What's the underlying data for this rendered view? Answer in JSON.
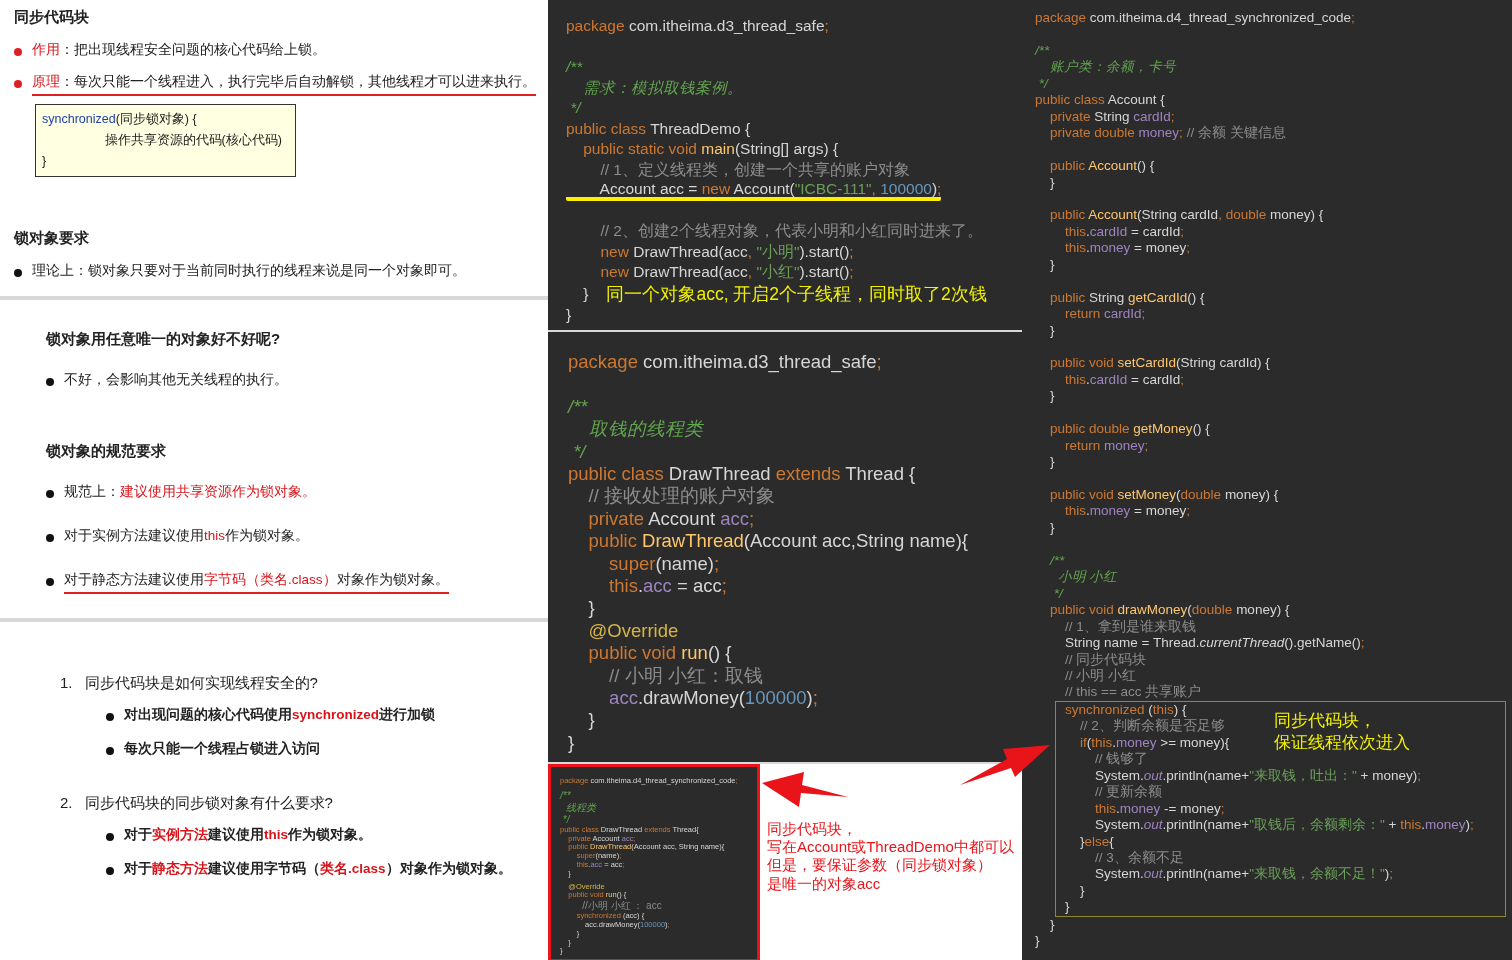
{
  "slides": [
    {
      "kind": "notes",
      "sections": [
        {
          "heading": "同步代码块",
          "bullets": [
            {
              "color": "#e02020",
              "underlined": false,
              "segments": [
                {
                  "kind": "red",
                  "text": "作用"
                },
                {
                  "kind": "plain",
                  "text": "：把出现线程安全问题的核心代码给上锁。"
                }
              ]
            },
            {
              "color": "#e02020",
              "underlined": true,
              "segments": [
                {
                  "kind": "red",
                  "text": "原理"
                },
                {
                  "kind": "plain",
                  "text": "：每次只能一个线程进入，执行完毕后自动解锁，其他线程才可以进来执行。"
                }
              ]
            }
          ],
          "code_box": [
            [
              {
                "kind": "blue",
                "text": "synchronized"
              },
              {
                "kind": "plain",
                "text": "(同步锁对象) {"
              }
            ],
            [
              {
                "kind": "plain",
                "text": "                  操作共享资源的代码(核心代码)"
              }
            ],
            [
              {
                "kind": "plain",
                "text": "}"
              }
            ]
          ]
        },
        {
          "heading": "锁对象要求",
          "bullets": [
            {
              "underlined": false,
              "segments": [
                {
                  "kind": "plain",
                  "text": "理论上：锁对象只要对于当前同时执行的线程来说是同一个对象即可。"
                }
              ]
            }
          ]
        }
      ]
    },
    {
      "kind": "notes",
      "sections": [
        {
          "heading": "锁对象用任意唯一的对象好不好呢?",
          "bullets": [
            {
              "underlined": false,
              "segments": [
                {
                  "kind": "plain",
                  "text": "不好，会影响其他无关线程的执行。"
                }
              ]
            }
          ]
        },
        {
          "heading": "锁对象的规范要求",
          "bullets": [
            {
              "underlined": false,
              "segments": [
                {
                  "kind": "plain",
                  "text": "规范上："
                },
                {
                  "kind": "red",
                  "text": "建议使用共享资源作为锁对象。"
                }
              ]
            },
            {
              "underlined": false,
              "segments": [
                {
                  "kind": "plain",
                  "text": "对于实例方法建议使用"
                },
                {
                  "kind": "red",
                  "text": "this"
                },
                {
                  "kind": "plain",
                  "text": "作为锁对象。"
                }
              ]
            },
            {
              "underlined": true,
              "segments": [
                {
                  "kind": "plain",
                  "text": "对于静态方法建议使用"
                },
                {
                  "kind": "red",
                  "text": "字节码（类名.class）"
                },
                {
                  "kind": "plain",
                  "text": "对象作为锁对象。"
                }
              ]
            }
          ]
        }
      ]
    },
    {
      "kind": "quiz",
      "sections": [
        {
          "number": "1.",
          "heading": "同步代码块是如何实现线程安全的?",
          "bullets": [
            {
              "segments": [
                {
                  "kind": "plain",
                  "text": "对出现问题的核心代码使用"
                },
                {
                  "kind": "red",
                  "text": "synchronized"
                },
                {
                  "kind": "plain",
                  "text": "进行加锁"
                }
              ]
            },
            {
              "segments": [
                {
                  "kind": "plain",
                  "text": "每次只能一个线程占锁进入访问"
                }
              ]
            }
          ]
        },
        {
          "number": "2.",
          "heading": "同步代码块的同步锁对象有什么要求?",
          "bullets": [
            {
              "segments": [
                {
                  "kind": "plain",
                  "text": "对于"
                },
                {
                  "kind": "red",
                  "text": "实例方法"
                },
                {
                  "kind": "plain",
                  "text": "建议使用"
                },
                {
                  "kind": "red",
                  "text": "this"
                },
                {
                  "kind": "plain",
                  "text": "作为锁对象。"
                }
              ]
            },
            {
              "segments": [
                {
                  "kind": "plain",
                  "text": "对于"
                },
                {
                  "kind": "red",
                  "text": "静态方法"
                },
                {
                  "kind": "plain",
                  "text": "建议使用字节码（"
                },
                {
                  "kind": "red",
                  "text": "类名.class"
                },
                {
                  "kind": "plain",
                  "text": "）对象作为锁对象。"
                }
              ]
            }
          ]
        }
      ]
    }
  ],
  "editor_top": {
    "lines": [
      {
        "kind": "code",
        "tokens": [
          {
            "kind": "kw",
            "text": "package "
          },
          {
            "kind": "plain",
            "text": "com.itheima.d3_thread_safe"
          },
          {
            "kind": "kw",
            "text": ";"
          }
        ]
      },
      {
        "kind": "blank"
      },
      {
        "kind": "code",
        "tokens": [
          {
            "kind": "doc",
            "text": "/**"
          }
        ]
      },
      {
        "kind": "code",
        "tokens": [
          {
            "kind": "doc",
            "text": "    需求：模拟取钱案例。"
          }
        ]
      },
      {
        "kind": "code",
        "tokens": [
          {
            "kind": "doc",
            "text": " */"
          }
        ]
      },
      {
        "kind": "code",
        "tokens": [
          {
            "kind": "kw",
            "text": "public class "
          },
          {
            "kind": "plain",
            "text": "ThreadDemo {"
          }
        ]
      },
      {
        "kind": "code",
        "tokens": [
          {
            "kind": "kw",
            "text": "    public static void "
          },
          {
            "kind": "method",
            "text": "main"
          },
          {
            "kind": "plain",
            "text": "(String[] args) {"
          }
        ]
      },
      {
        "kind": "code",
        "tokens": [
          {
            "kind": "comment",
            "text": "        // 1、定义线程类，创建一个共享的账户对象"
          }
        ]
      },
      {
        "kind": "code",
        "underlined": true,
        "tokens": [
          {
            "kind": "plain",
            "text": "        Account acc = "
          },
          {
            "kind": "kw",
            "text": "new "
          },
          {
            "kind": "plain",
            "text": "Account("
          },
          {
            "kind": "str",
            "text": "\"ICBC-111\""
          },
          {
            "kind": "kw",
            "text": ", "
          },
          {
            "kind": "num",
            "text": "100000"
          },
          {
            "kind": "plain",
            "text": ")"
          },
          {
            "kind": "kw",
            "text": ";"
          }
        ]
      },
      {
        "kind": "blank"
      },
      {
        "kind": "code",
        "tokens": [
          {
            "kind": "comment",
            "text": "        // 2、创建2个线程对象，代表小明和小红同时进来了。"
          }
        ]
      },
      {
        "kind": "code",
        "tokens": [
          {
            "kind": "kw",
            "text": "        new "
          },
          {
            "kind": "plain",
            "text": "DrawThread(acc"
          },
          {
            "kind": "kw",
            "text": ", "
          },
          {
            "kind": "str",
            "text": "\"小明\""
          },
          {
            "kind": "plain",
            "text": ").start()"
          },
          {
            "kind": "kw",
            "text": ";"
          }
        ]
      },
      {
        "kind": "code",
        "tokens": [
          {
            "kind": "kw",
            "text": "        new "
          },
          {
            "kind": "plain",
            "text": "DrawThread(acc"
          },
          {
            "kind": "kw",
            "text": ", "
          },
          {
            "kind": "str",
            "text": "\"小红\""
          },
          {
            "kind": "plain",
            "text": ").start()"
          },
          {
            "kind": "kw",
            "text": ";"
          }
        ]
      },
      {
        "kind": "code",
        "note": "同一个对象acc, 开启2个子线程，同时取了2次钱",
        "tokens": [
          {
            "kind": "plain",
            "text": "    }"
          }
        ]
      },
      {
        "kind": "code",
        "tokens": [
          {
            "kind": "plain",
            "text": "}"
          }
        ]
      }
    ]
  },
  "editor_bottom": {
    "lines": [
      {
        "kind": "code",
        "tokens": [
          {
            "kind": "kw",
            "text": "package "
          },
          {
            "kind": "plain",
            "text": "com.itheima.d3_thread_safe"
          },
          {
            "kind": "kw",
            "text": ";"
          }
        ]
      },
      {
        "kind": "blank"
      },
      {
        "kind": "code",
        "tokens": [
          {
            "kind": "doc",
            "text": "/**"
          }
        ]
      },
      {
        "kind": "code",
        "tokens": [
          {
            "kind": "doc",
            "text": "    取钱的线程类"
          }
        ]
      },
      {
        "kind": "code",
        "tokens": [
          {
            "kind": "doc",
            "text": " */"
          }
        ]
      },
      {
        "kind": "code",
        "tokens": [
          {
            "kind": "kw",
            "text": "public class "
          },
          {
            "kind": "plain",
            "text": "DrawThread "
          },
          {
            "kind": "kw",
            "text": "extends "
          },
          {
            "kind": "plain",
            "text": "Thread {"
          }
        ]
      },
      {
        "kind": "code",
        "tokens": [
          {
            "kind": "comment",
            "text": "    // 接收处理的账户对象"
          }
        ]
      },
      {
        "kind": "code",
        "tokens": [
          {
            "kind": "kw",
            "text": "    private "
          },
          {
            "kind": "plain",
            "text": "Account "
          },
          {
            "kind": "field",
            "text": "acc"
          },
          {
            "kind": "kw",
            "text": ";"
          }
        ]
      },
      {
        "kind": "code",
        "tokens": [
          {
            "kind": "kw",
            "text": "    public "
          },
          {
            "kind": "method",
            "text": "DrawThread"
          },
          {
            "kind": "plain",
            "text": "(Account acc,String name){"
          }
        ]
      },
      {
        "kind": "code",
        "tokens": [
          {
            "kind": "kw",
            "text": "        super"
          },
          {
            "kind": "plain",
            "text": "(name)"
          },
          {
            "kind": "kw",
            "text": ";"
          }
        ]
      },
      {
        "kind": "code",
        "tokens": [
          {
            "kind": "kw",
            "text": "        this"
          },
          {
            "kind": "plain",
            "text": "."
          },
          {
            "kind": "field",
            "text": "acc"
          },
          {
            "kind": "plain",
            "text": " = acc"
          },
          {
            "kind": "kw",
            "text": ";"
          }
        ]
      },
      {
        "kind": "code",
        "tokens": [
          {
            "kind": "plain",
            "text": "    }"
          }
        ]
      },
      {
        "kind": "code",
        "tokens": [
          {
            "kind": "anno",
            "text": "    @Override"
          }
        ]
      },
      {
        "kind": "code",
        "tokens": [
          {
            "kind": "kw",
            "text": "    public void "
          },
          {
            "kind": "method",
            "text": "run"
          },
          {
            "kind": "plain",
            "text": "() {"
          }
        ]
      },
      {
        "kind": "code",
        "tokens": [
          {
            "kind": "comment",
            "text": "        // 小明 小红：取钱"
          }
        ]
      },
      {
        "kind": "code",
        "tokens": [
          {
            "kind": "field",
            "text": "        acc"
          },
          {
            "kind": "plain",
            "text": ".drawMoney("
          },
          {
            "kind": "num",
            "text": "100000"
          },
          {
            "kind": "plain",
            "text": ")"
          },
          {
            "kind": "kw",
            "text": ";"
          }
        ]
      },
      {
        "kind": "code",
        "tokens": [
          {
            "kind": "plain",
            "text": "    }"
          }
        ]
      },
      {
        "kind": "code",
        "tokens": [
          {
            "kind": "plain",
            "text": "}"
          }
        ]
      }
    ]
  },
  "thumbnail": {
    "lines": [
      {
        "kind": "code",
        "tokens": [
          {
            "kind": "kw",
            "text": "package "
          },
          {
            "kind": "plain",
            "text": "com.itheima.d4_thread_synchronized_code"
          },
          {
            "kind": "kw",
            "text": ";"
          }
        ]
      },
      {
        "kind": "blank"
      },
      {
        "kind": "code",
        "tokens": [
          {
            "kind": "doc",
            "text": "/**"
          }
        ]
      },
      {
        "kind": "code",
        "tokens": [
          {
            "kind": "doc",
            "text": "  线程类"
          }
        ]
      },
      {
        "kind": "code",
        "tokens": [
          {
            "kind": "doc",
            "text": " */"
          }
        ]
      },
      {
        "kind": "code",
        "tokens": [
          {
            "kind": "kw",
            "text": "public class "
          },
          {
            "kind": "plain",
            "text": "DrawThread "
          },
          {
            "kind": "kw",
            "text": "extends "
          },
          {
            "kind": "plain",
            "text": "Thread{"
          }
        ]
      },
      {
        "kind": "code",
        "tokens": [
          {
            "kind": "kw",
            "text": "    private "
          },
          {
            "kind": "plain",
            "text": "Account "
          },
          {
            "kind": "field",
            "text": "acc"
          },
          {
            "kind": "kw",
            "text": ";"
          }
        ]
      },
      {
        "kind": "code",
        "tokens": [
          {
            "kind": "kw",
            "text": "    public "
          },
          {
            "kind": "method",
            "text": "DrawThread"
          },
          {
            "kind": "plain",
            "text": "(Account acc, String name){"
          }
        ]
      },
      {
        "kind": "code",
        "tokens": [
          {
            "kind": "kw",
            "text": "        super"
          },
          {
            "kind": "plain",
            "text": "(name)"
          },
          {
            "kind": "kw",
            "text": ";"
          }
        ]
      },
      {
        "kind": "code",
        "tokens": [
          {
            "kind": "kw",
            "text": "        this"
          },
          {
            "kind": "plain",
            "text": "."
          },
          {
            "kind": "field",
            "text": "acc"
          },
          {
            "kind": "plain",
            "text": " = acc"
          },
          {
            "kind": "kw",
            "text": ";"
          }
        ]
      },
      {
        "kind": "code",
        "tokens": [
          {
            "kind": "plain",
            "text": "    }"
          }
        ]
      },
      {
        "kind": "blank"
      },
      {
        "kind": "code",
        "tokens": [
          {
            "kind": "anno",
            "text": "    @Override"
          }
        ]
      },
      {
        "kind": "code",
        "tokens": [
          {
            "kind": "kw",
            "text": "    public void "
          },
          {
            "kind": "method",
            "text": "run"
          },
          {
            "kind": "plain",
            "text": "() {"
          }
        ]
      },
      {
        "kind": "code",
        "tokens": [
          {
            "kind": "comment",
            "text": "        //小明 小红 ： acc"
          }
        ]
      },
      {
        "kind": "code",
        "tokens": [
          {
            "kind": "kw",
            "text": "        synchronized "
          },
          {
            "kind": "plain",
            "text": "(acc) {"
          }
        ]
      },
      {
        "kind": "code",
        "tokens": [
          {
            "kind": "plain",
            "text": "            acc.drawMoney("
          },
          {
            "kind": "num",
            "text": "100000"
          },
          {
            "kind": "plain",
            "text": ")"
          },
          {
            "kind": "kw",
            "text": ";"
          }
        ]
      },
      {
        "kind": "code",
        "tokens": [
          {
            "kind": "plain",
            "text": "        }"
          }
        ]
      },
      {
        "kind": "code",
        "tokens": [
          {
            "kind": "plain",
            "text": "    }"
          }
        ]
      },
      {
        "kind": "code",
        "tokens": [
          {
            "kind": "plain",
            "text": "}"
          }
        ]
      }
    ]
  },
  "annotation": {
    "lines": [
      "同步代码块，",
      "写在Account或ThreadDemo中都可以",
      "但是，要保证参数（同步锁对象）",
      "是唯一的对象acc"
    ]
  },
  "editor_right": {
    "lines": [
      {
        "kind": "code",
        "tokens": [
          {
            "kind": "kw",
            "text": "package "
          },
          {
            "kind": "plain",
            "text": "com.itheima.d4_thread_synchronized_code"
          },
          {
            "kind": "kw",
            "text": ";"
          }
        ]
      },
      {
        "kind": "blank"
      },
      {
        "kind": "code",
        "tokens": [
          {
            "kind": "doc",
            "text": "/**"
          }
        ]
      },
      {
        "kind": "code",
        "tokens": [
          {
            "kind": "doc",
            "text": "    账户类：余额，卡号"
          }
        ]
      },
      {
        "kind": "code",
        "tokens": [
          {
            "kind": "doc",
            "text": " */"
          }
        ]
      },
      {
        "kind": "code",
        "tokens": [
          {
            "kind": "kw",
            "text": "public class "
          },
          {
            "kind": "plain",
            "text": "Account {"
          }
        ]
      },
      {
        "kind": "code",
        "tokens": [
          {
            "kind": "kw",
            "text": "    private "
          },
          {
            "kind": "plain",
            "text": "String "
          },
          {
            "kind": "field",
            "text": "cardId"
          },
          {
            "kind": "kw",
            "text": ";"
          }
        ]
      },
      {
        "kind": "code",
        "tokens": [
          {
            "kind": "kw",
            "text": "    private double "
          },
          {
            "kind": "field",
            "text": "money"
          },
          {
            "kind": "kw",
            "text": "; "
          },
          {
            "kind": "comment",
            "text": "// 余额 关键信息"
          }
        ]
      },
      {
        "kind": "blank"
      },
      {
        "kind": "code",
        "tokens": [
          {
            "kind": "kw",
            "text": "    public "
          },
          {
            "kind": "method",
            "text": "Account"
          },
          {
            "kind": "plain",
            "text": "() {"
          }
        ]
      },
      {
        "kind": "code",
        "tokens": [
          {
            "kind": "plain",
            "text": "    }"
          }
        ]
      },
      {
        "kind": "blank"
      },
      {
        "kind": "code",
        "tokens": [
          {
            "kind": "kw",
            "text": "    public "
          },
          {
            "kind": "method",
            "text": "Account"
          },
          {
            "kind": "plain",
            "text": "(String cardId"
          },
          {
            "kind": "kw",
            "text": ", double "
          },
          {
            "kind": "plain",
            "text": "money) {"
          }
        ]
      },
      {
        "kind": "code",
        "tokens": [
          {
            "kind": "kw",
            "text": "        this"
          },
          {
            "kind": "plain",
            "text": "."
          },
          {
            "kind": "field",
            "text": "cardId"
          },
          {
            "kind": "plain",
            "text": " = cardId"
          },
          {
            "kind": "kw",
            "text": ";"
          }
        ]
      },
      {
        "kind": "code",
        "tokens": [
          {
            "kind": "kw",
            "text": "        this"
          },
          {
            "kind": "plain",
            "text": "."
          },
          {
            "kind": "field",
            "text": "money"
          },
          {
            "kind": "plain",
            "text": " = money"
          },
          {
            "kind": "kw",
            "text": ";"
          }
        ]
      },
      {
        "kind": "code",
        "tokens": [
          {
            "kind": "plain",
            "text": "    }"
          }
        ]
      },
      {
        "kind": "blank"
      },
      {
        "kind": "code",
        "tokens": [
          {
            "kind": "kw",
            "text": "    public "
          },
          {
            "kind": "plain",
            "text": "String "
          },
          {
            "kind": "method",
            "text": "getCardId"
          },
          {
            "kind": "plain",
            "text": "() {"
          }
        ]
      },
      {
        "kind": "code",
        "tokens": [
          {
            "kind": "kw",
            "text": "        return "
          },
          {
            "kind": "field",
            "text": "cardId"
          },
          {
            "kind": "kw",
            "text": ";"
          }
        ]
      },
      {
        "kind": "code",
        "tokens": [
          {
            "kind": "plain",
            "text": "    }"
          }
        ]
      },
      {
        "kind": "blank"
      },
      {
        "kind": "code",
        "tokens": [
          {
            "kind": "kw",
            "text": "    public void "
          },
          {
            "kind": "method",
            "text": "setCardId"
          },
          {
            "kind": "plain",
            "text": "(String cardId) {"
          }
        ]
      },
      {
        "kind": "code",
        "tokens": [
          {
            "kind": "kw",
            "text": "        this"
          },
          {
            "kind": "plain",
            "text": "."
          },
          {
            "kind": "field",
            "text": "cardId"
          },
          {
            "kind": "plain",
            "text": " = cardId"
          },
          {
            "kind": "kw",
            "text": ";"
          }
        ]
      },
      {
        "kind": "code",
        "tokens": [
          {
            "kind": "plain",
            "text": "    }"
          }
        ]
      },
      {
        "kind": "blank"
      },
      {
        "kind": "code",
        "tokens": [
          {
            "kind": "kw",
            "text": "    public double "
          },
          {
            "kind": "method",
            "text": "getMoney"
          },
          {
            "kind": "plain",
            "text": "() {"
          }
        ]
      },
      {
        "kind": "code",
        "tokens": [
          {
            "kind": "kw",
            "text": "        return "
          },
          {
            "kind": "field",
            "text": "money"
          },
          {
            "kind": "kw",
            "text": ";"
          }
        ]
      },
      {
        "kind": "code",
        "tokens": [
          {
            "kind": "plain",
            "text": "    }"
          }
        ]
      },
      {
        "kind": "blank"
      },
      {
        "kind": "code",
        "tokens": [
          {
            "kind": "kw",
            "text": "    public void "
          },
          {
            "kind": "method",
            "text": "setMoney"
          },
          {
            "kind": "plain",
            "text": "("
          },
          {
            "kind": "kw",
            "text": "double "
          },
          {
            "kind": "plain",
            "text": "money) {"
          }
        ]
      },
      {
        "kind": "code",
        "tokens": [
          {
            "kind": "kw",
            "text": "        this"
          },
          {
            "kind": "plain",
            "text": "."
          },
          {
            "kind": "field",
            "text": "money"
          },
          {
            "kind": "plain",
            "text": " = money"
          },
          {
            "kind": "kw",
            "text": ";"
          }
        ]
      },
      {
        "kind": "code",
        "tokens": [
          {
            "kind": "plain",
            "text": "    }"
          }
        ]
      },
      {
        "kind": "blank"
      },
      {
        "kind": "code",
        "tokens": [
          {
            "kind": "doc",
            "text": "    /**"
          }
        ]
      },
      {
        "kind": "code",
        "tokens": [
          {
            "kind": "doc",
            "text": "      小明 小红"
          }
        ]
      },
      {
        "kind": "code",
        "tokens": [
          {
            "kind": "doc",
            "text": "     */"
          }
        ]
      },
      {
        "kind": "code",
        "tokens": [
          {
            "kind": "kw",
            "text": "    public void "
          },
          {
            "kind": "method",
            "text": "drawMoney"
          },
          {
            "kind": "plain",
            "text": "("
          },
          {
            "kind": "kw",
            "text": "double "
          },
          {
            "kind": "plain",
            "text": "money) {"
          }
        ]
      },
      {
        "kind": "code",
        "tokens": [
          {
            "kind": "comment",
            "text": "        // 1、拿到是谁来取钱"
          }
        ]
      },
      {
        "kind": "code",
        "tokens": [
          {
            "kind": "plain",
            "text": "        String name = Thread."
          },
          {
            "kind": "italic",
            "text": "currentThread"
          },
          {
            "kind": "plain",
            "text": "().getName()"
          },
          {
            "kind": "kw",
            "text": ";"
          }
        ]
      },
      {
        "kind": "code",
        "tokens": [
          {
            "kind": "comment",
            "text": "        // 同步代码块"
          }
        ]
      },
      {
        "kind": "code",
        "tokens": [
          {
            "kind": "comment",
            "text": "        // 小明 小红"
          }
        ]
      },
      {
        "kind": "code",
        "tokens": [
          {
            "kind": "comment",
            "text": "        // this == acc 共享账户"
          }
        ]
      }
    ],
    "highlight": {
      "note": [
        "同步代码块，",
        "保证线程依次进入"
      ],
      "lines": [
        {
          "kind": "code",
          "tokens": [
            {
              "kind": "kw",
              "text": "        synchronized "
            },
            {
              "kind": "plain",
              "text": "("
            },
            {
              "kind": "kw",
              "text": "this"
            },
            {
              "kind": "plain",
              "text": ") {"
            }
          ]
        },
        {
          "kind": "code",
          "tokens": [
            {
              "kind": "comment",
              "text": "            // 2、判断余额是否足够"
            }
          ]
        },
        {
          "kind": "code",
          "tokens": [
            {
              "kind": "kw",
              "text": "            if"
            },
            {
              "kind": "plain",
              "text": "("
            },
            {
              "kind": "kw",
              "text": "this"
            },
            {
              "kind": "plain",
              "text": "."
            },
            {
              "kind": "field",
              "text": "money"
            },
            {
              "kind": "plain",
              "text": " >= money){"
            }
          ]
        },
        {
          "kind": "code",
          "tokens": [
            {
              "kind": "comment",
              "text": "                // 钱够了"
            }
          ]
        },
        {
          "kind": "code",
          "tokens": [
            {
              "kind": "plain",
              "text": "                System."
            },
            {
              "kind": "static_field",
              "text": "out"
            },
            {
              "kind": "plain",
              "text": ".println(name+"
            },
            {
              "kind": "str",
              "text": "\"来取钱，吐出：\""
            },
            {
              "kind": "plain",
              "text": " + money)"
            },
            {
              "kind": "kw",
              "text": ";"
            }
          ]
        },
        {
          "kind": "code",
          "tokens": [
            {
              "kind": "comment",
              "text": "                // 更新余额"
            }
          ]
        },
        {
          "kind": "code",
          "tokens": [
            {
              "kind": "kw",
              "text": "                this"
            },
            {
              "kind": "plain",
              "text": "."
            },
            {
              "kind": "field",
              "text": "money"
            },
            {
              "kind": "plain",
              "text": " -= money"
            },
            {
              "kind": "kw",
              "text": ";"
            }
          ]
        },
        {
          "kind": "code",
          "tokens": [
            {
              "kind": "plain",
              "text": "                System."
            },
            {
              "kind": "static_field",
              "text": "out"
            },
            {
              "kind": "plain",
              "text": ".println(name+"
            },
            {
              "kind": "str",
              "text": "\"取钱后，余额剩余：\""
            },
            {
              "kind": "plain",
              "text": " + "
            },
            {
              "kind": "kw",
              "text": "this"
            },
            {
              "kind": "plain",
              "text": "."
            },
            {
              "kind": "field",
              "text": "money"
            },
            {
              "kind": "plain",
              "text": ")"
            },
            {
              "kind": "kw",
              "text": ";"
            }
          ]
        },
        {
          "kind": "code",
          "tokens": [
            {
              "kind": "plain",
              "text": "            }"
            },
            {
              "kind": "kw",
              "text": "else"
            },
            {
              "kind": "plain",
              "text": "{"
            }
          ]
        },
        {
          "kind": "code",
          "tokens": [
            {
              "kind": "comment",
              "text": "                // 3、余额不足"
            }
          ]
        },
        {
          "kind": "code",
          "tokens": [
            {
              "kind": "plain",
              "text": "                System."
            },
            {
              "kind": "static_field",
              "text": "out"
            },
            {
              "kind": "plain",
              "text": ".println(name+"
            },
            {
              "kind": "str",
              "text": "\"来取钱，余额不足！\""
            },
            {
              "kind": "plain",
              "text": ")"
            },
            {
              "kind": "kw",
              "text": ";"
            }
          ]
        },
        {
          "kind": "code",
          "tokens": [
            {
              "kind": "plain",
              "text": "            }"
            }
          ]
        },
        {
          "kind": "code",
          "tokens": [
            {
              "kind": "plain",
              "text": "        }"
            }
          ]
        }
      ]
    },
    "lines_after": [
      {
        "kind": "code",
        "tokens": [
          {
            "kind": "plain",
            "text": "    }"
          }
        ]
      },
      {
        "kind": "code",
        "tokens": [
          {
            "kind": "plain",
            "text": "}"
          }
        ]
      }
    ]
  }
}
